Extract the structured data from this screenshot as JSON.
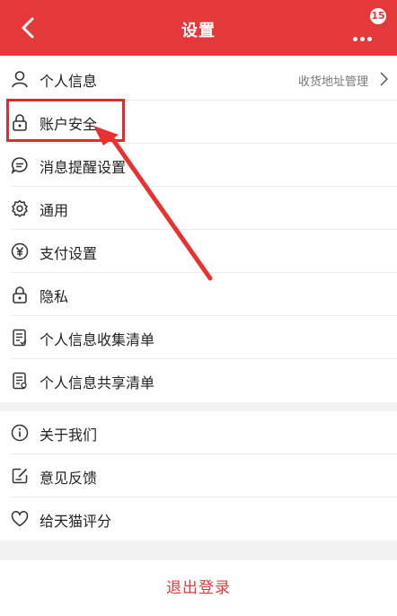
{
  "header": {
    "title": "设置",
    "badge": "15",
    "icons": {
      "back": "chevron-left-icon",
      "more": "more-dots-icon"
    }
  },
  "group1": {
    "items": [
      {
        "label": "个人信息",
        "sub": "收货地址管理",
        "icon": "user-icon"
      },
      {
        "label": "账户安全",
        "icon": "lock-icon"
      },
      {
        "label": "消息提醒设置",
        "icon": "message-icon"
      },
      {
        "label": "通用",
        "icon": "gear-icon"
      },
      {
        "label": "支付设置",
        "icon": "yen-icon"
      },
      {
        "label": "隐私",
        "icon": "privacy-lock-icon"
      },
      {
        "label": "个人信息收集清单",
        "icon": "document-icon"
      },
      {
        "label": "个人信息共享清单",
        "icon": "document-share-icon"
      }
    ]
  },
  "group2": {
    "items": [
      {
        "label": "关于我们",
        "icon": "info-icon"
      },
      {
        "label": "意见反馈",
        "icon": "feedback-icon"
      },
      {
        "label": "给天猫评分",
        "icon": "heart-icon"
      }
    ]
  },
  "logout": {
    "label": "退出登录"
  },
  "colors": {
    "brand": "#e5383b",
    "highlight": "#e02c2c"
  }
}
